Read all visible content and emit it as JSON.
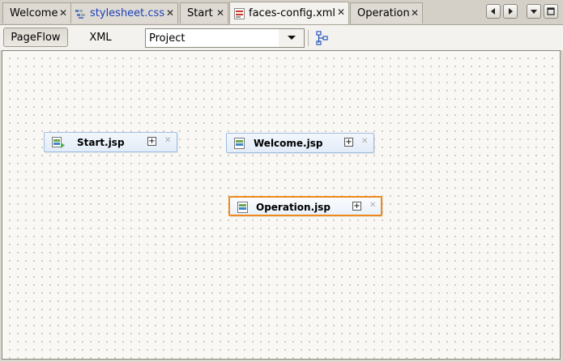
{
  "tabs": [
    {
      "label": "Welcome",
      "icon": "none"
    },
    {
      "label": "stylesheet.css",
      "icon": "css-file-icon"
    },
    {
      "label": "Start",
      "icon": "none"
    },
    {
      "label": "faces-config.xml",
      "icon": "xml-file-icon",
      "active": true
    },
    {
      "label": "Operation",
      "icon": "none"
    }
  ],
  "tab_close_glyph": "✕",
  "toolbar": {
    "pageflow_label": "PageFlow",
    "xml_label": "XML",
    "scope_value": "Project"
  },
  "nodes": [
    {
      "label": "Start.jsp",
      "is_start": true,
      "selected": false
    },
    {
      "label": "Welcome.jsp",
      "is_start": false,
      "selected": false
    },
    {
      "label": "Operation.jsp",
      "is_start": false,
      "selected": true
    }
  ],
  "colors": {
    "selection": "#f08a1c",
    "node_border": "#9fbde4",
    "css_tab_text": "#1a3fb8"
  }
}
